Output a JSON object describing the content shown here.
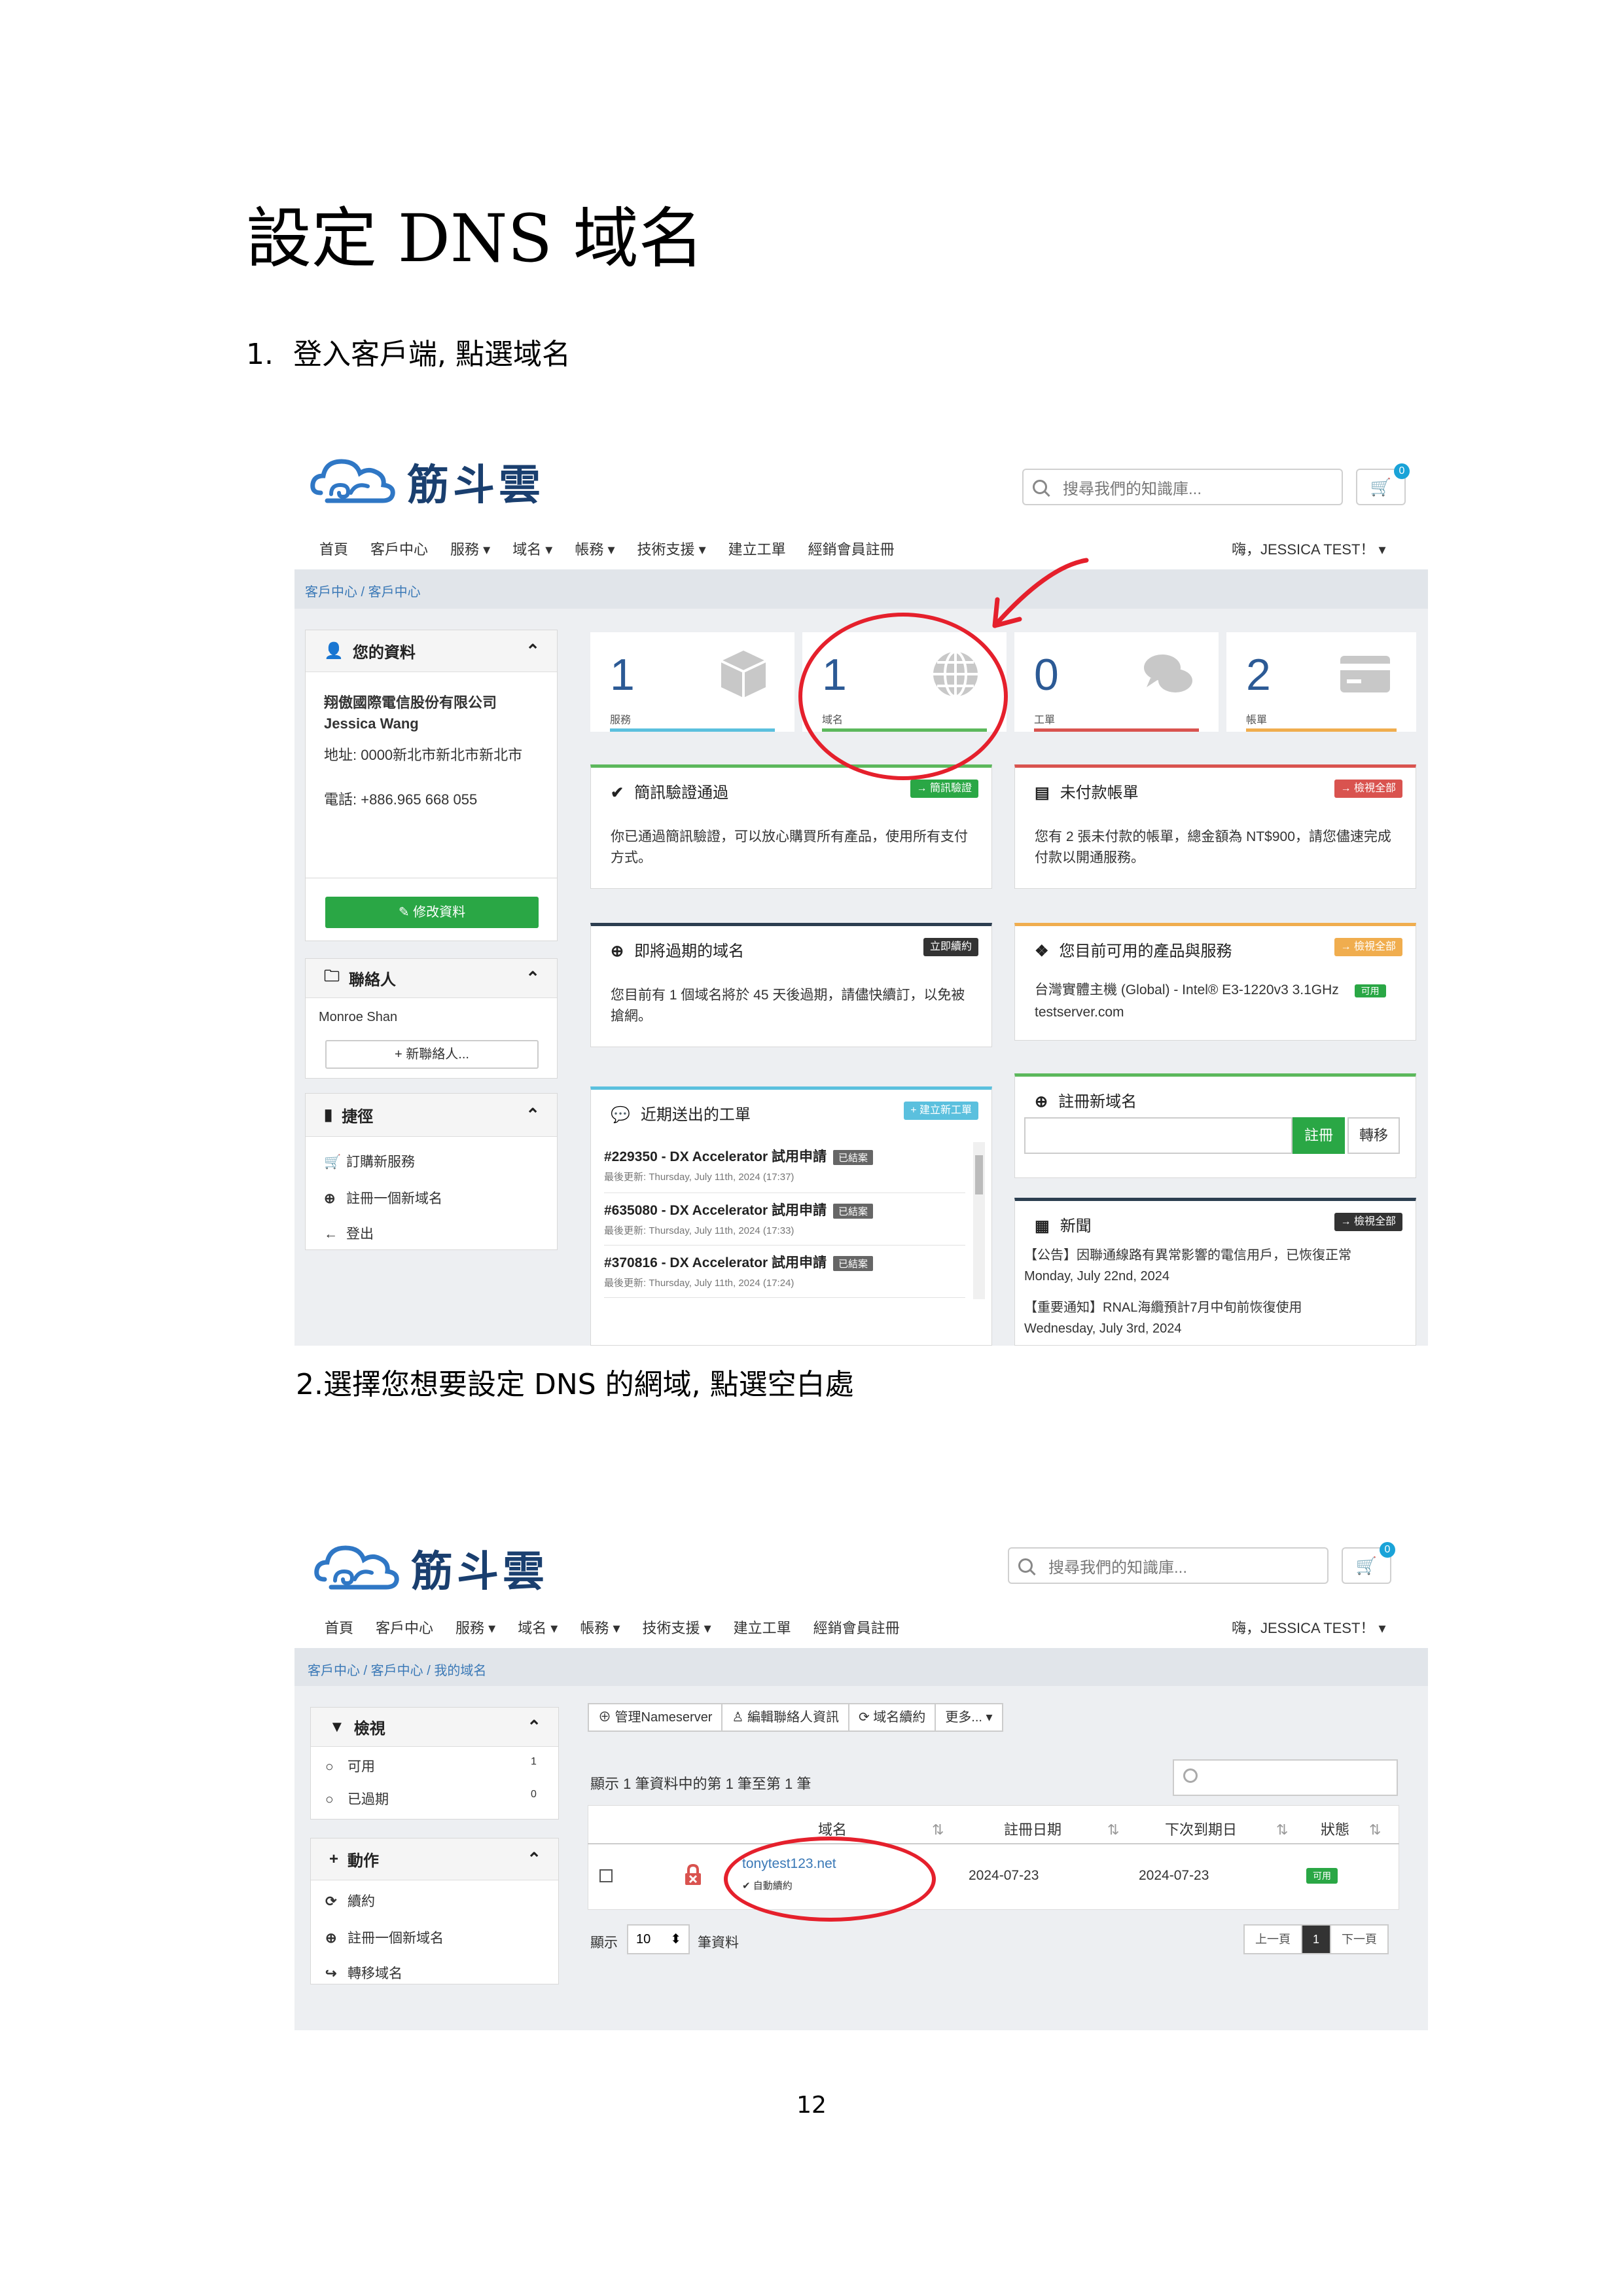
{
  "doc_title": "設定 DNS 域名",
  "step1": {
    "num": "1.",
    "text": "登入客戶端, 點選域名"
  },
  "step2": {
    "text": "2.選擇您想要設定 DNS 的網域, 點選空白處"
  },
  "page_number": "12",
  "site": {
    "logo_text": "筋斗雲",
    "search_placeholder": "搜尋我們的知識庫...",
    "cart_count": "0",
    "nav": [
      "首頁",
      "客戶中心",
      "服務 ▾",
      "域名 ▾",
      "帳務 ▾",
      "技術支援 ▾",
      "建立工單",
      "經銷會員註冊"
    ],
    "user": "嗨，JESSICA TEST！ ▾"
  },
  "shot1": {
    "breadcrumb": "客戶中心 / 客戶中心",
    "profile": {
      "title": "您的資料",
      "company": "翔傲國際電信股份有限公司",
      "name": "Jessica Wang",
      "address": "地址: 0000新北市新北市新北市",
      "phone": "電話: +886.965 668 055",
      "edit_button": "✎ 修改資料"
    },
    "contacts": {
      "title": "聯絡人",
      "item": "Monroe Shan",
      "add_button": "+ 新聯絡人..."
    },
    "shortcuts": {
      "title": "捷徑",
      "items": [
        "訂購新服務",
        "註冊一個新域名",
        "登出"
      ]
    },
    "stats": [
      {
        "n": "1",
        "label": "服務",
        "color": "#5bc0de"
      },
      {
        "n": "1",
        "label": "域名",
        "color": "#5cb85c"
      },
      {
        "n": "0",
        "label": "工單",
        "color": "#d9534f"
      },
      {
        "n": "2",
        "label": "帳單",
        "color": "#f0ad4e"
      }
    ],
    "cards": {
      "sms": {
        "title": "簡訊驗證通過",
        "tag": "→ 簡訊驗證",
        "text": "你已通過簡訊驗證，可以放心購買所有產品，使用所有支付方式。"
      },
      "unpaid": {
        "title": "未付款帳單",
        "tag": "→ 檢視全部",
        "text": "您有 2 張未付款的帳單，總金額為 NT$900，請您儘速完成付款以開通服務。"
      },
      "expiring": {
        "title": "即將過期的域名",
        "tag": "立即續約",
        "text": "您目前有 1 個域名將於 45 天後過期，請儘快續訂，以免被搶網。"
      },
      "products": {
        "title": "您目前可用的產品與服務",
        "tag": "→ 檢視全部",
        "line1": "台灣實體主機 (Global) - Intel® E3-1220v3 3.1GHz",
        "badge": "可用",
        "line2": "testserver.com"
      },
      "tickets": {
        "title": "近期送出的工單",
        "tag": "+ 建立新工單",
        "items": [
          {
            "title": "#229350 - DX Accelerator 試用申請",
            "status": "已結案",
            "updated": "最後更新: Thursday, July 11th, 2024 (17:37)"
          },
          {
            "title": "#635080 - DX Accelerator 試用申請",
            "status": "已結案",
            "updated": "最後更新: Thursday, July 11th, 2024 (17:33)"
          },
          {
            "title": "#370816 - DX Accelerator 試用申請",
            "status": "已結案",
            "updated": "最後更新: Thursday, July 11th, 2024 (17:24)"
          }
        ]
      },
      "register": {
        "title": "註冊新域名",
        "register_btn": "註冊",
        "transfer_btn": "轉移"
      },
      "news": {
        "title": "新聞",
        "tag": "→ 檢視全部",
        "items": [
          {
            "title": "【公告】因聯通線路有異常影響的電信用戶，已恢復正常",
            "date": "Monday, July 22nd, 2024"
          },
          {
            "title": "【重要通知】RNAL海纜預計7月中旬前恢復使用",
            "date": "Wednesday, July 3rd, 2024"
          }
        ]
      }
    }
  },
  "shot2": {
    "breadcrumb": "客戶中心 / 客戶中心 / 我的域名",
    "filter": {
      "title": "檢視",
      "items": [
        {
          "label": "可用",
          "count": "1"
        },
        {
          "label": "已過期",
          "count": "0"
        }
      ]
    },
    "actions": {
      "title": "動作",
      "items": [
        "續約",
        "註冊一個新域名",
        "轉移域名"
      ]
    },
    "toolbar": [
      "⊕ 管理Nameserver",
      "♙ 編輯聯絡人資訊",
      "⟳ 域名續約",
      "更多... ▾"
    ],
    "showing": "顯示 1 筆資料中的第 1 筆至第 1 筆",
    "columns": [
      "域名",
      "註冊日期",
      "下次到期日",
      "狀態"
    ],
    "row": {
      "domain": "tonytest123.net",
      "auto": "✔ 自動續約",
      "reg_date": "2024-07-23",
      "due_date": "2024-07-23",
      "status": "可用"
    },
    "page_size_label_pre": "顯示",
    "page_size": "10",
    "page_size_label_post": "筆資料",
    "pager": [
      "上一頁",
      "1",
      "下一頁"
    ]
  }
}
